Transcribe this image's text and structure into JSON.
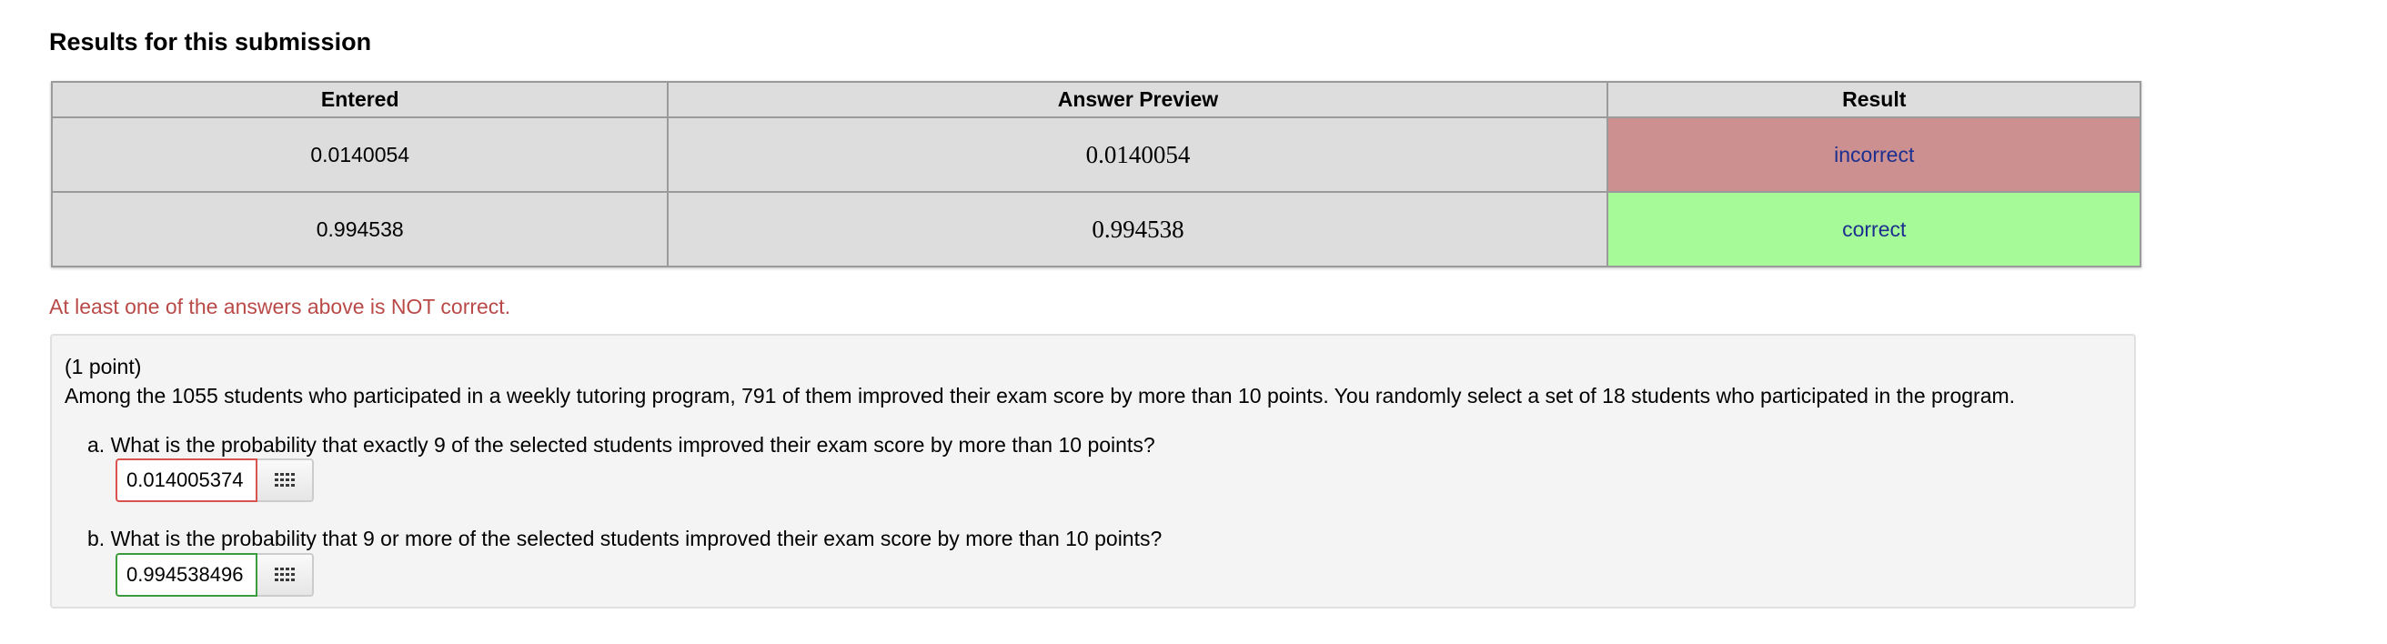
{
  "heading": "Results for this submission",
  "table": {
    "headers": [
      "Entered",
      "Answer Preview",
      "Result"
    ],
    "rows": [
      {
        "entered": "0.0140054",
        "preview": "0.0140054",
        "result": "incorrect"
      },
      {
        "entered": "0.994538",
        "preview": "0.994538",
        "result": "correct"
      }
    ]
  },
  "colors": {
    "incorrect_bg": "#cc9090",
    "correct_bg": "#a7fa98",
    "warning_text": "#b94a48",
    "result_text": "#1c2f8f"
  },
  "warning": "At least one of the answers above is NOT correct.",
  "problem": {
    "points": "(1 point)",
    "statement": "Among the 1055 students who participated in a weekly tutoring program, 791 of them improved their exam score by more than 10 points. You randomly select a set of 18 students who participated in the program.",
    "parts": [
      {
        "question": "a. What is the probability that exactly 9 of the selected students improved their exam score by more than 10 points?",
        "answer": "0.014005374",
        "status": "incorrect",
        "palette_icon": "grid-icon"
      },
      {
        "question": "b. What is the probability that 9 or more of the selected students improved their exam score by more than 10 points?",
        "answer": "0.994538496",
        "status": "correct",
        "palette_icon": "grid-icon"
      }
    ]
  }
}
